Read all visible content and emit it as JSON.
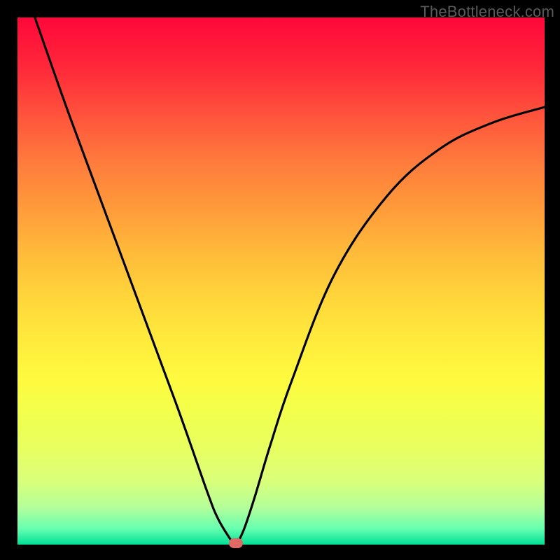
{
  "attribution": "TheBottleneck.com",
  "chart_data": {
    "type": "line",
    "title": "",
    "xlabel": "",
    "ylabel": "",
    "xlim": [
      0,
      100
    ],
    "ylim": [
      0,
      100
    ],
    "series": [
      {
        "name": "curve",
        "x": [
          3.3,
          10,
          20,
          30,
          36,
          38,
          40,
          41,
          41.5,
          43,
          45,
          48,
          52,
          60,
          70,
          80,
          90,
          100
        ],
        "y": [
          100,
          81,
          54,
          27,
          10,
          5,
          1.6,
          0.2,
          0,
          3,
          9,
          19,
          31,
          51,
          66,
          75,
          80,
          83
        ]
      }
    ],
    "marker": {
      "x": 41.5,
      "y": 0
    },
    "background_gradient": {
      "top": "#ff073a",
      "bottom": "#00e097"
    }
  }
}
